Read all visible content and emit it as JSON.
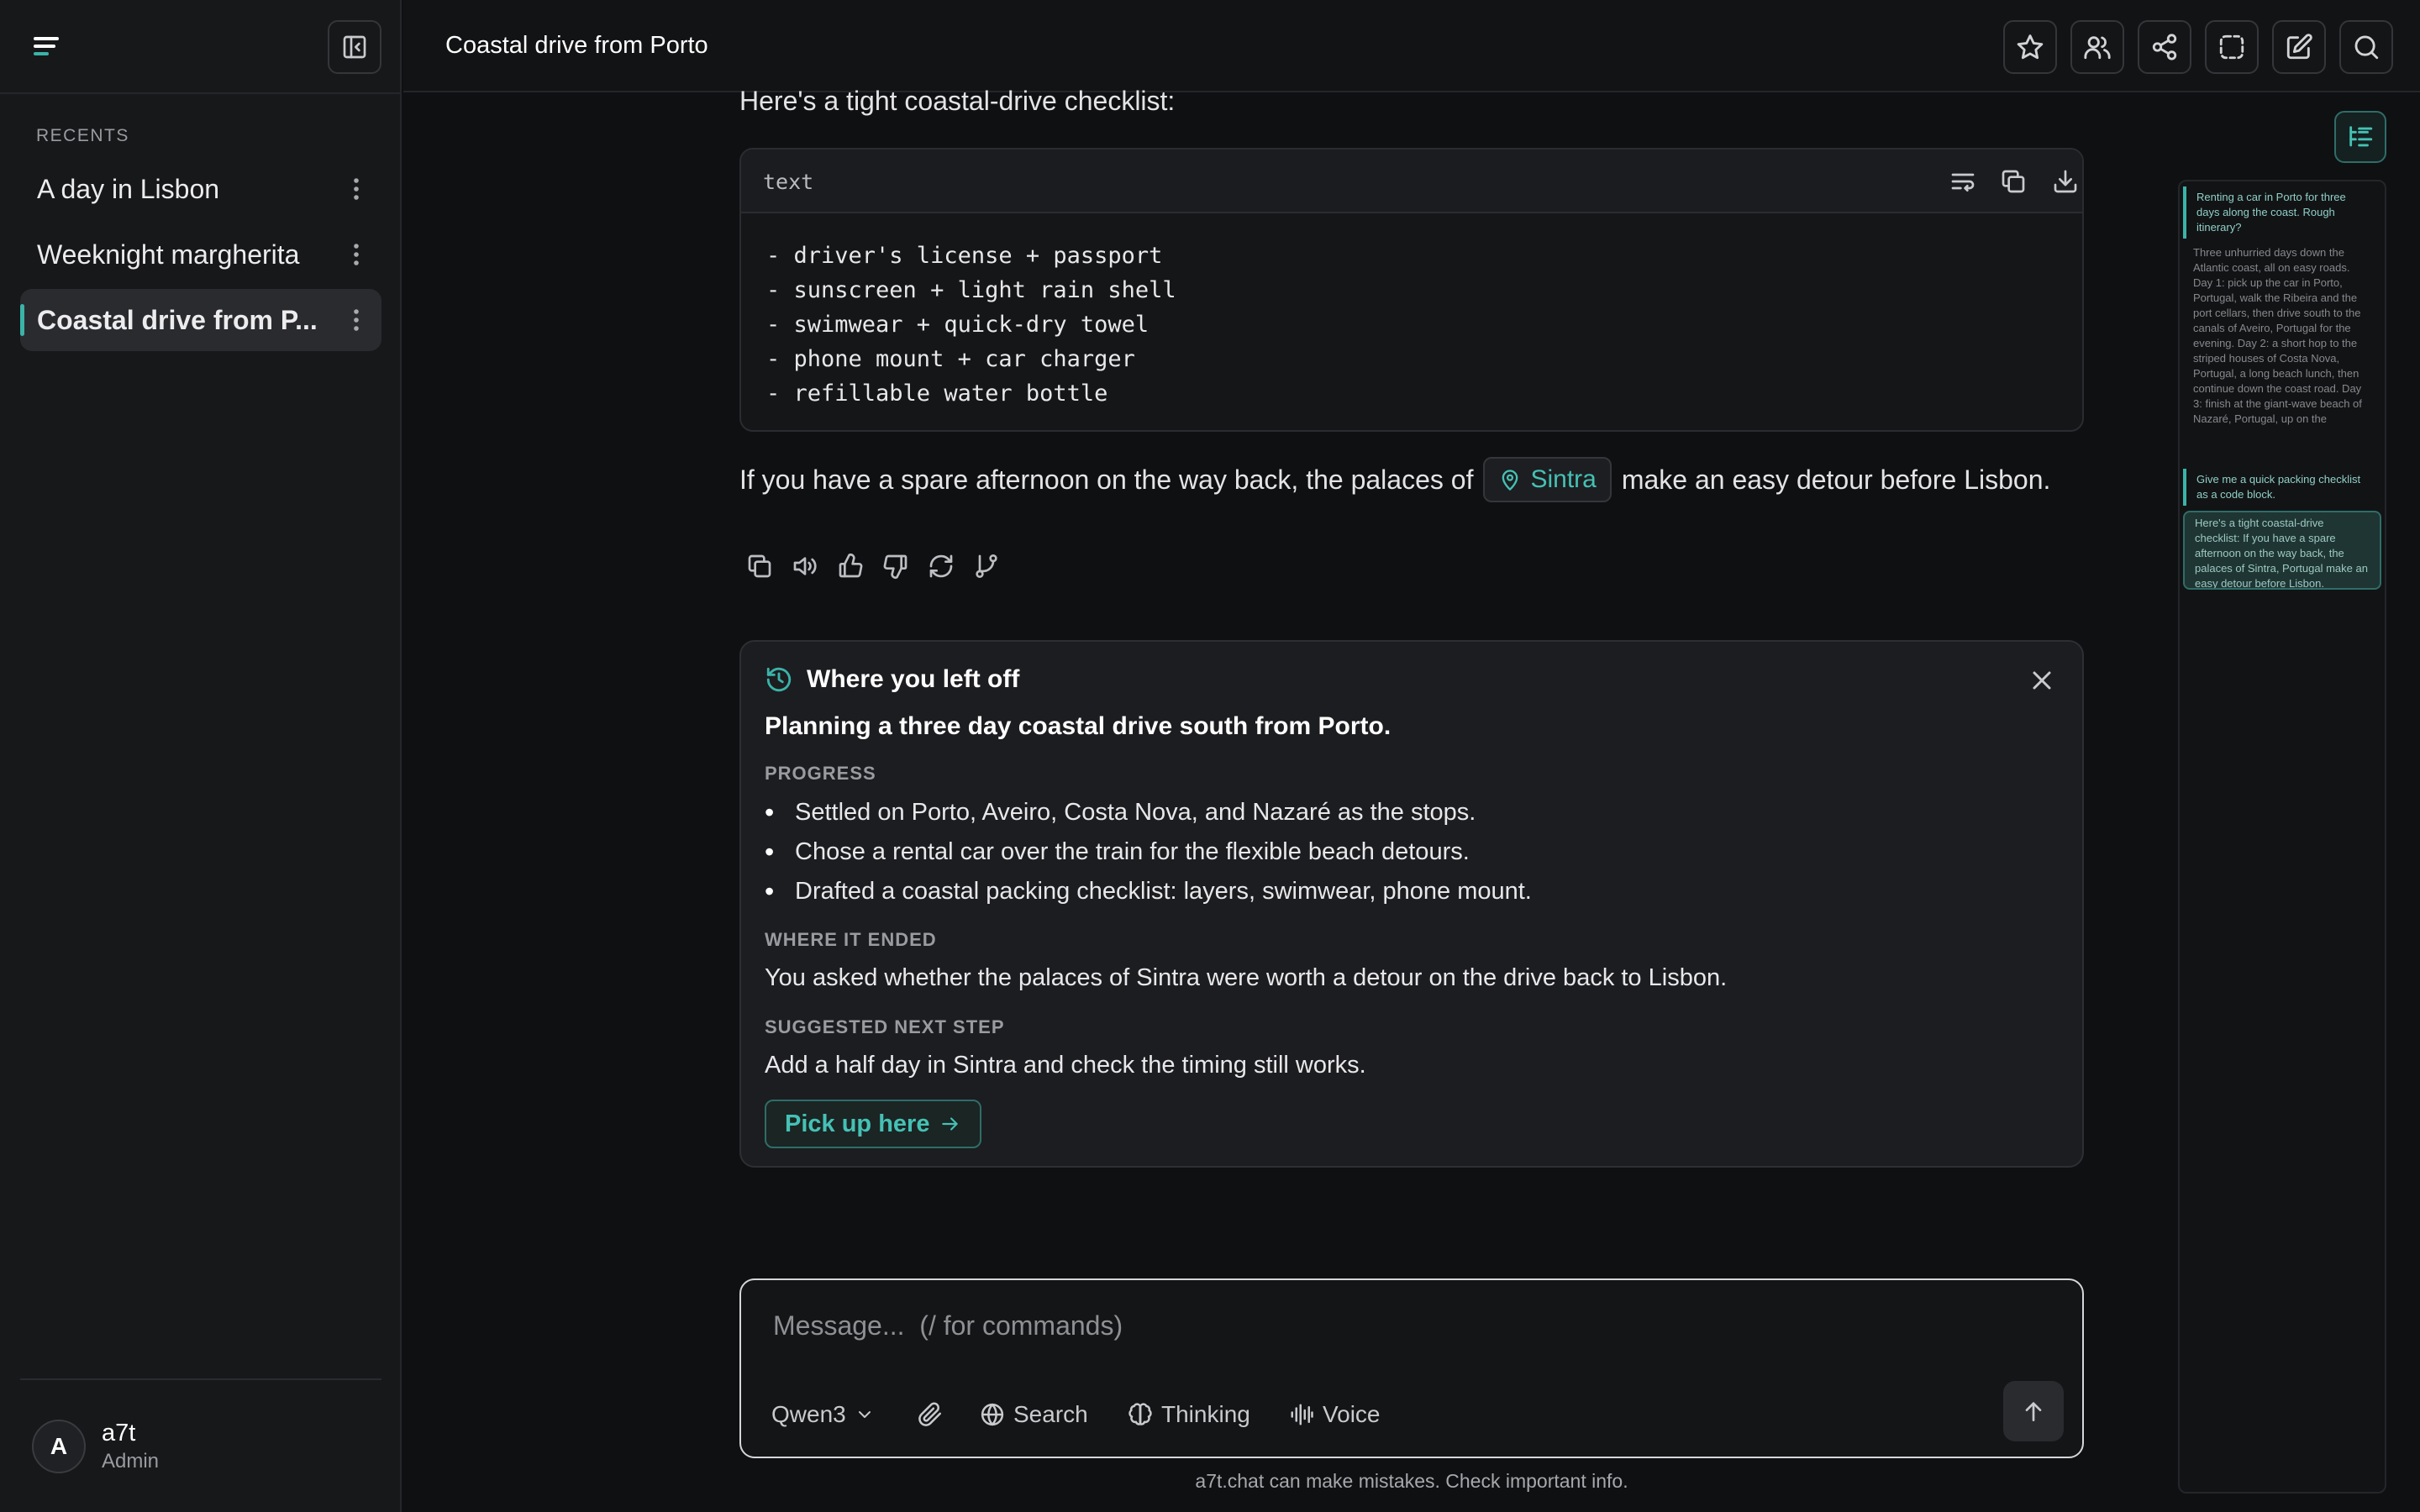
{
  "app": {
    "title": "Coastal drive from Porto",
    "footer_note": "a7t.chat can make mistakes. Check important info."
  },
  "sidebar": {
    "recents_label": "RECENTS",
    "items": [
      {
        "label": "A day in Lisbon",
        "active": false
      },
      {
        "label": "Weeknight margherita",
        "active": false
      },
      {
        "label": "Coastal drive from P...",
        "active": true
      }
    ],
    "user": {
      "initial": "A",
      "name": "a7t",
      "role": "Admin"
    }
  },
  "header_icons": [
    "star-icon",
    "users-icon",
    "share-icon",
    "dashed-selection-icon",
    "edit-icon",
    "search-icon"
  ],
  "conversation": {
    "intro": "Here's a tight coastal-drive checklist:",
    "code": {
      "language": "text",
      "lines": [
        "- driver's license + passport",
        "- sunscreen + light rain shell",
        "- swimwear + quick-dry towel",
        "- phone mount + car charger",
        "- refillable water bottle"
      ]
    },
    "paragraph": {
      "before": "If you have a spare afternoon on the way back, the palaces of",
      "place_chip": "Sintra",
      "after": "make an easy detour before Lisbon."
    }
  },
  "resume_card": {
    "heading": "Where you left off",
    "summary": "Planning a three day coastal drive south from Porto.",
    "progress_label": "PROGRESS",
    "progress": [
      "Settled on Porto, Aveiro, Costa Nova, and Nazaré as the stops.",
      "Chose a rental car over the train for the flexible beach detours.",
      "Drafted a coastal packing checklist: layers, swimwear, phone mount."
    ],
    "ended_label": "WHERE IT ENDED",
    "ended_text": "You asked whether the palaces of Sintra were worth a detour on the drive back to Lisbon.",
    "next_label": "SUGGESTED NEXT STEP",
    "next_text": "Add a half day in Sintra and check the timing still works.",
    "button": "Pick up here"
  },
  "composer": {
    "placeholder": "Message...  (/ for commands)",
    "model": "Qwen3",
    "search": "Search",
    "thinking": "Thinking",
    "voice": "Voice"
  },
  "minimap": {
    "blocks": [
      "Renting a car in Porto for three days along the coast. Rough itinerary?",
      "Three unhurried days down the Atlantic coast, all on easy roads. Day 1: pick up the car in Porto, Portugal, walk the Ribeira and the port cellars, then drive south to the canals of Aveiro, Portugal for the evening. Day 2: a short hop to the striped houses of Costa Nova, Portugal, a long beach lunch, then continue down the coast road. Day 3: finish at the giant-wave beach of Nazaré, Portugal, up on the headland for the view, before turning back inland.",
      "Give me a quick packing checklist as a code block.",
      "Here's a tight coastal-drive checklist: If you have a spare afternoon on the way back, the palaces of Sintra, Portugal make an easy detour before Lisbon."
    ]
  }
}
